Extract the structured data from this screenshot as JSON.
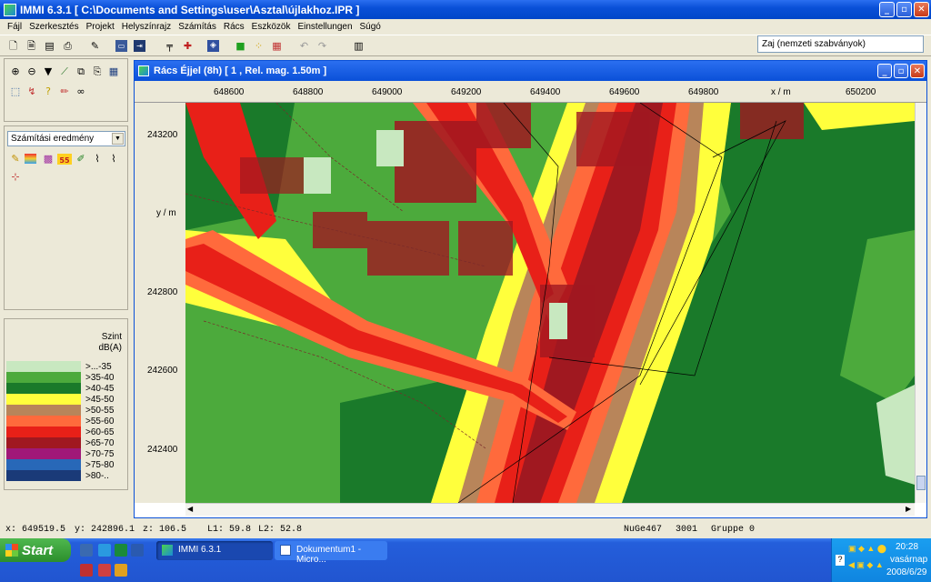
{
  "window": {
    "title": "IMMI 6.3.1 [ C:\\Documents and Settings\\user\\Asztal\\újlakhoz.IPR ]"
  },
  "menu": [
    "Fájl",
    "Szerkesztés",
    "Projekt",
    "Helyszínrajz",
    "Számítás",
    "Rács",
    "Eszközök",
    "Einstellungen",
    "Súgó"
  ],
  "standard_select": {
    "value": "Zaj (nemzeti szabványok)"
  },
  "result_select": {
    "value": "Számítási eredmény"
  },
  "child_window": {
    "title": "Rács Éjjel (8h)  [ 1 , Rel. mag.  1.50m ]",
    "x_ticks": [
      "648600",
      "648800",
      "649000",
      "649200",
      "649400",
      "649600",
      "649800",
      "x / m",
      "650200"
    ],
    "y_ticks": [
      "243200",
      "y / m",
      "242800",
      "242600",
      "242400"
    ]
  },
  "legend": {
    "title": "Szint",
    "unit": "dB(A)",
    "rows": [
      {
        "label": ">...-35",
        "color": "#c8e8c0"
      },
      {
        "label": ">35-40",
        "color": "#4caa3c"
      },
      {
        "label": ">40-45",
        "color": "#1a7a2a"
      },
      {
        "label": ">45-50",
        "color": "#ffff3c"
      },
      {
        "label": ">50-55",
        "color": "#b8855a"
      },
      {
        "label": ">55-60",
        "color": "#ff6a3c"
      },
      {
        "label": ">60-65",
        "color": "#e82018"
      },
      {
        "label": ">65-70",
        "color": "#a01820"
      },
      {
        "label": ">70-75",
        "color": "#a01878"
      },
      {
        "label": ">75-80",
        "color": "#2868b8"
      },
      {
        "label": ">80-..",
        "color": "#1a3a78"
      }
    ]
  },
  "status": {
    "x": "x: 649519.5",
    "y": "y: 242896.1",
    "z": "z:  106.5",
    "l1": "L1:  59.8",
    "l2": "L2:  52.8",
    "code": "NuGe467",
    "num": "3001",
    "gruppe": "Gruppe 0"
  },
  "taskbar": {
    "start": "Start",
    "tasks": [
      "IMMI 6.3.1",
      "Dokumentum1 - Micro..."
    ],
    "clock": "20:28",
    "day": "vasárnap",
    "date": "2008/6/29"
  }
}
